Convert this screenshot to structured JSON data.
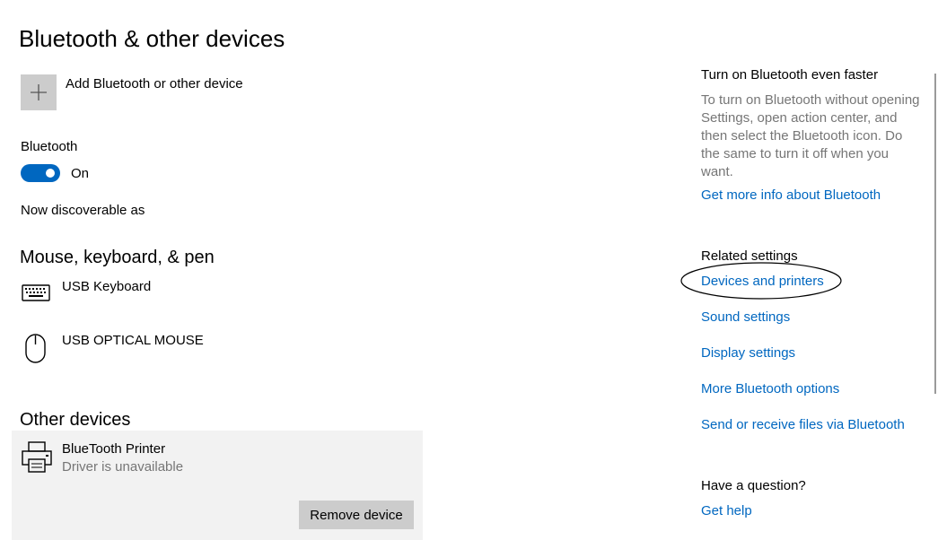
{
  "page": {
    "title": "Bluetooth & other devices"
  },
  "add_device": {
    "label": "Add Bluetooth or other device",
    "icon": "plus-icon"
  },
  "bluetooth": {
    "label": "Bluetooth",
    "toggle_state": "On",
    "on": true,
    "discoverable_text": "Now discoverable as"
  },
  "mouse_keyboard_pen": {
    "title": "Mouse, keyboard, & pen",
    "devices": [
      {
        "name": "USB Keyboard",
        "icon": "keyboard-icon"
      },
      {
        "name": "USB OPTICAL MOUSE",
        "icon": "mouse-icon"
      }
    ]
  },
  "other_devices": {
    "title": "Other devices",
    "devices": [
      {
        "name": "BlueTooth Printer",
        "status": "Driver is unavailable",
        "icon": "printer-icon",
        "remove_label": "Remove device"
      }
    ]
  },
  "right_panel": {
    "faster": {
      "heading": "Turn on Bluetooth even faster",
      "description": "To turn on Bluetooth without opening Settings, open action center, and then select the Bluetooth icon. Do the same to turn it off when you want.",
      "link": "Get more info about Bluetooth"
    },
    "related": {
      "heading": "Related settings",
      "links": [
        "Devices and printers",
        "Sound settings",
        "Display settings",
        "More Bluetooth options",
        "Send or receive files via Bluetooth"
      ]
    },
    "question": {
      "heading": "Have a question?",
      "link": "Get help"
    }
  },
  "colors": {
    "accent": "#0067c0",
    "secondary_text": "#767676",
    "button_gray": "#cccccc",
    "panel_bg": "#f2f2f2"
  }
}
